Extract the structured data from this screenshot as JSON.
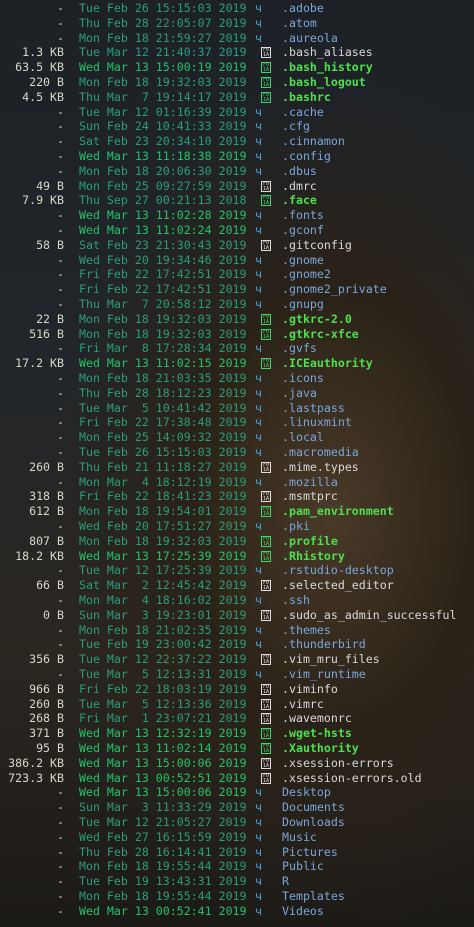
{
  "listing": [
    {
      "size": "-",
      "date": "Tue Feb 26 15:15:03 2019",
      "name": ".adobe",
      "kind": "dir",
      "dc": "teal"
    },
    {
      "size": "-",
      "date": "Thu Feb 28 22:05:07 2019",
      "name": ".atom",
      "kind": "dir",
      "dc": "teal"
    },
    {
      "size": "-",
      "date": "Mon Feb 18 21:59:27 2019",
      "name": ".aureola",
      "kind": "dir",
      "dc": "teal"
    },
    {
      "size": "1.3 KB",
      "date": "Tue Mar 12 21:40:37 2019",
      "name": ".bash_aliases",
      "kind": "file",
      "dc": "teal"
    },
    {
      "size": "63.5 KB",
      "date": "Wed Mar 13 15:00:19 2019",
      "name": ".bash_history",
      "kind": "exe",
      "dc": "green"
    },
    {
      "size": "220 B",
      "date": "Mon Feb 18 19:32:03 2019",
      "name": ".bash_logout",
      "kind": "exe",
      "dc": "teal"
    },
    {
      "size": "4.5 KB",
      "date": "Thu Mar  7 19:14:17 2019",
      "name": ".bashrc",
      "kind": "exe",
      "dc": "teal"
    },
    {
      "size": "-",
      "date": "Tue Mar 12 01:16:39 2019",
      "name": ".cache",
      "kind": "dir",
      "dc": "teal"
    },
    {
      "size": "-",
      "date": "Sun Feb 24 10:41:33 2019",
      "name": ".cfg",
      "kind": "dir",
      "dc": "teal"
    },
    {
      "size": "-",
      "date": "Sat Feb 23 20:34:10 2019",
      "name": ".cinnamon",
      "kind": "dir",
      "dc": "teal"
    },
    {
      "size": "-",
      "date": "Wed Mar 13 11:18:38 2019",
      "name": ".config",
      "kind": "dir",
      "dc": "green"
    },
    {
      "size": "-",
      "date": "Mon Feb 18 20:06:30 2019",
      "name": ".dbus",
      "kind": "dir",
      "dc": "teal"
    },
    {
      "size": "49 B",
      "date": "Mon Feb 25 09:27:59 2019",
      "name": ".dmrc",
      "kind": "file",
      "dc": "teal"
    },
    {
      "size": "7.9 KB",
      "date": "Thu Sep 27 00:21:13 2018",
      "name": ".face",
      "kind": "exe",
      "dc": "teal"
    },
    {
      "size": "-",
      "date": "Wed Mar 13 11:02:28 2019",
      "name": ".fonts",
      "kind": "dir",
      "dc": "green"
    },
    {
      "size": "-",
      "date": "Wed Mar 13 11:02:24 2019",
      "name": ".gconf",
      "kind": "dir",
      "dc": "green"
    },
    {
      "size": "58 B",
      "date": "Sat Feb 23 21:30:43 2019",
      "name": ".gitconfig",
      "kind": "file",
      "dc": "teal"
    },
    {
      "size": "-",
      "date": "Wed Feb 20 19:34:46 2019",
      "name": ".gnome",
      "kind": "dir",
      "dc": "teal"
    },
    {
      "size": "-",
      "date": "Fri Feb 22 17:42:51 2019",
      "name": ".gnome2",
      "kind": "dir",
      "dc": "teal"
    },
    {
      "size": "-",
      "date": "Fri Feb 22 17:42:51 2019",
      "name": ".gnome2_private",
      "kind": "dir",
      "dc": "teal"
    },
    {
      "size": "-",
      "date": "Thu Mar  7 20:58:12 2019",
      "name": ".gnupg",
      "kind": "dir",
      "dc": "teal"
    },
    {
      "size": "22 B",
      "date": "Mon Feb 18 19:32:03 2019",
      "name": ".gtkrc-2.0",
      "kind": "exe",
      "dc": "teal"
    },
    {
      "size": "516 B",
      "date": "Mon Feb 18 19:32:03 2019",
      "name": ".gtkrc-xfce",
      "kind": "exe",
      "dc": "teal"
    },
    {
      "size": "-",
      "date": "Fri Mar  8 17:28:34 2019",
      "name": ".gvfs",
      "kind": "dir",
      "dc": "teal"
    },
    {
      "size": "17.2 KB",
      "date": "Wed Mar 13 11:02:15 2019",
      "name": ".ICEauthority",
      "kind": "exe",
      "dc": "green"
    },
    {
      "size": "-",
      "date": "Mon Feb 18 21:03:35 2019",
      "name": ".icons",
      "kind": "dir",
      "dc": "teal"
    },
    {
      "size": "-",
      "date": "Thu Feb 28 18:12:23 2019",
      "name": ".java",
      "kind": "dir",
      "dc": "teal"
    },
    {
      "size": "-",
      "date": "Tue Mar  5 10:41:42 2019",
      "name": ".lastpass",
      "kind": "dir",
      "dc": "teal"
    },
    {
      "size": "-",
      "date": "Fri Feb 22 17:38:48 2019",
      "name": ".linuxmint",
      "kind": "dir",
      "dc": "teal"
    },
    {
      "size": "-",
      "date": "Mon Feb 25 14:09:32 2019",
      "name": ".local",
      "kind": "dir",
      "dc": "teal"
    },
    {
      "size": "-",
      "date": "Tue Feb 26 15:15:03 2019",
      "name": ".macromedia",
      "kind": "dir",
      "dc": "teal"
    },
    {
      "size": "260 B",
      "date": "Thu Feb 21 11:18:27 2019",
      "name": ".mime.types",
      "kind": "file",
      "dc": "teal"
    },
    {
      "size": "-",
      "date": "Mon Mar  4 18:12:19 2019",
      "name": ".mozilla",
      "kind": "dir",
      "dc": "teal"
    },
    {
      "size": "318 B",
      "date": "Fri Feb 22 18:41:23 2019",
      "name": ".msmtprc",
      "kind": "file",
      "dc": "teal"
    },
    {
      "size": "612 B",
      "date": "Mon Feb 18 19:54:01 2019",
      "name": ".pam_environment",
      "kind": "exe",
      "dc": "teal"
    },
    {
      "size": "-",
      "date": "Wed Feb 20 17:51:27 2019",
      "name": ".pki",
      "kind": "dir",
      "dc": "teal"
    },
    {
      "size": "807 B",
      "date": "Mon Feb 18 19:32:03 2019",
      "name": ".profile",
      "kind": "exe",
      "dc": "teal"
    },
    {
      "size": "18.2 KB",
      "date": "Wed Mar 13 17:25:39 2019",
      "name": ".Rhistory",
      "kind": "exe",
      "dc": "green"
    },
    {
      "size": "-",
      "date": "Tue Mar 12 17:25:39 2019",
      "name": ".rstudio-desktop",
      "kind": "dir",
      "dc": "teal"
    },
    {
      "size": "66 B",
      "date": "Sat Mar  2 12:45:42 2019",
      "name": ".selected_editor",
      "kind": "file",
      "dc": "teal"
    },
    {
      "size": "-",
      "date": "Mon Mar  4 18:16:02 2019",
      "name": ".ssh",
      "kind": "dir",
      "dc": "teal"
    },
    {
      "size": "0 B",
      "date": "Sun Mar  3 19:23:01 2019",
      "name": ".sudo_as_admin_successful",
      "kind": "file",
      "dc": "teal"
    },
    {
      "size": "-",
      "date": "Mon Feb 18 21:02:35 2019",
      "name": ".themes",
      "kind": "dir",
      "dc": "teal"
    },
    {
      "size": "-",
      "date": "Tue Feb 19 23:00:42 2019",
      "name": ".thunderbird",
      "kind": "dir",
      "dc": "teal"
    },
    {
      "size": "356 B",
      "date": "Tue Mar 12 22:37:22 2019",
      "name": ".vim_mru_files",
      "kind": "file",
      "dc": "teal"
    },
    {
      "size": "-",
      "date": "Tue Mar  5 12:13:31 2019",
      "name": ".vim_runtime",
      "kind": "dir",
      "dc": "teal"
    },
    {
      "size": "966 B",
      "date": "Fri Feb 22 18:03:19 2019",
      "name": ".viminfo",
      "kind": "file",
      "dc": "teal"
    },
    {
      "size": "260 B",
      "date": "Tue Mar  5 12:13:36 2019",
      "name": ".vimrc",
      "kind": "file",
      "dc": "teal"
    },
    {
      "size": "268 B",
      "date": "Fri Mar  1 23:07:21 2019",
      "name": ".wavemonrc",
      "kind": "file",
      "dc": "teal"
    },
    {
      "size": "371 B",
      "date": "Wed Mar 13 12:32:19 2019",
      "name": ".wget-hsts",
      "kind": "exe",
      "dc": "green"
    },
    {
      "size": "95 B",
      "date": "Wed Mar 13 11:02:14 2019",
      "name": ".Xauthority",
      "kind": "exe",
      "dc": "green"
    },
    {
      "size": "386.2 KB",
      "date": "Wed Mar 13 15:00:06 2019",
      "name": ".xsession-errors",
      "kind": "file",
      "dc": "green"
    },
    {
      "size": "723.3 KB",
      "date": "Wed Mar 13 00:52:51 2019",
      "name": ".xsession-errors.old",
      "kind": "file",
      "dc": "green"
    },
    {
      "size": "-",
      "date": "Wed Mar 13 15:00:06 2019",
      "name": "Desktop",
      "kind": "dir",
      "dc": "green"
    },
    {
      "size": "-",
      "date": "Sun Mar  3 11:33:29 2019",
      "name": "Documents",
      "kind": "dir",
      "dc": "teal"
    },
    {
      "size": "-",
      "date": "Tue Mar 12 21:05:27 2019",
      "name": "Downloads",
      "kind": "dir",
      "dc": "teal"
    },
    {
      "size": "-",
      "date": "Wed Feb 27 16:15:59 2019",
      "name": "Music",
      "kind": "dir",
      "dc": "teal"
    },
    {
      "size": "-",
      "date": "Thu Feb 28 16:14:41 2019",
      "name": "Pictures",
      "kind": "dir",
      "dc": "teal"
    },
    {
      "size": "-",
      "date": "Mon Feb 18 19:55:44 2019",
      "name": "Public",
      "kind": "dir",
      "dc": "teal"
    },
    {
      "size": "-",
      "date": "Tue Feb 19 13:43:31 2019",
      "name": "R",
      "kind": "dir",
      "dc": "teal"
    },
    {
      "size": "-",
      "date": "Mon Feb 18 19:55:44 2019",
      "name": "Templates",
      "kind": "dir",
      "dc": "teal"
    },
    {
      "size": "-",
      "date": "Wed Mar 13 00:52:41 2019",
      "name": "Videos",
      "kind": "dir",
      "dc": "green"
    }
  ],
  "icons": {
    "dir": "folder-icon",
    "file": "file-icon",
    "exe": "file-icon"
  },
  "glyphs": {
    "dir": "ч",
    "file_label": "F0\n1A"
  },
  "colors": {
    "date_recent": "#22c36a",
    "date_old": "#2a9d7a",
    "dir_name": "#7aa6d9",
    "file_name": "#d8d8d8",
    "highlight_name": "#4ee04e",
    "size_text": "#d8d8c8"
  }
}
